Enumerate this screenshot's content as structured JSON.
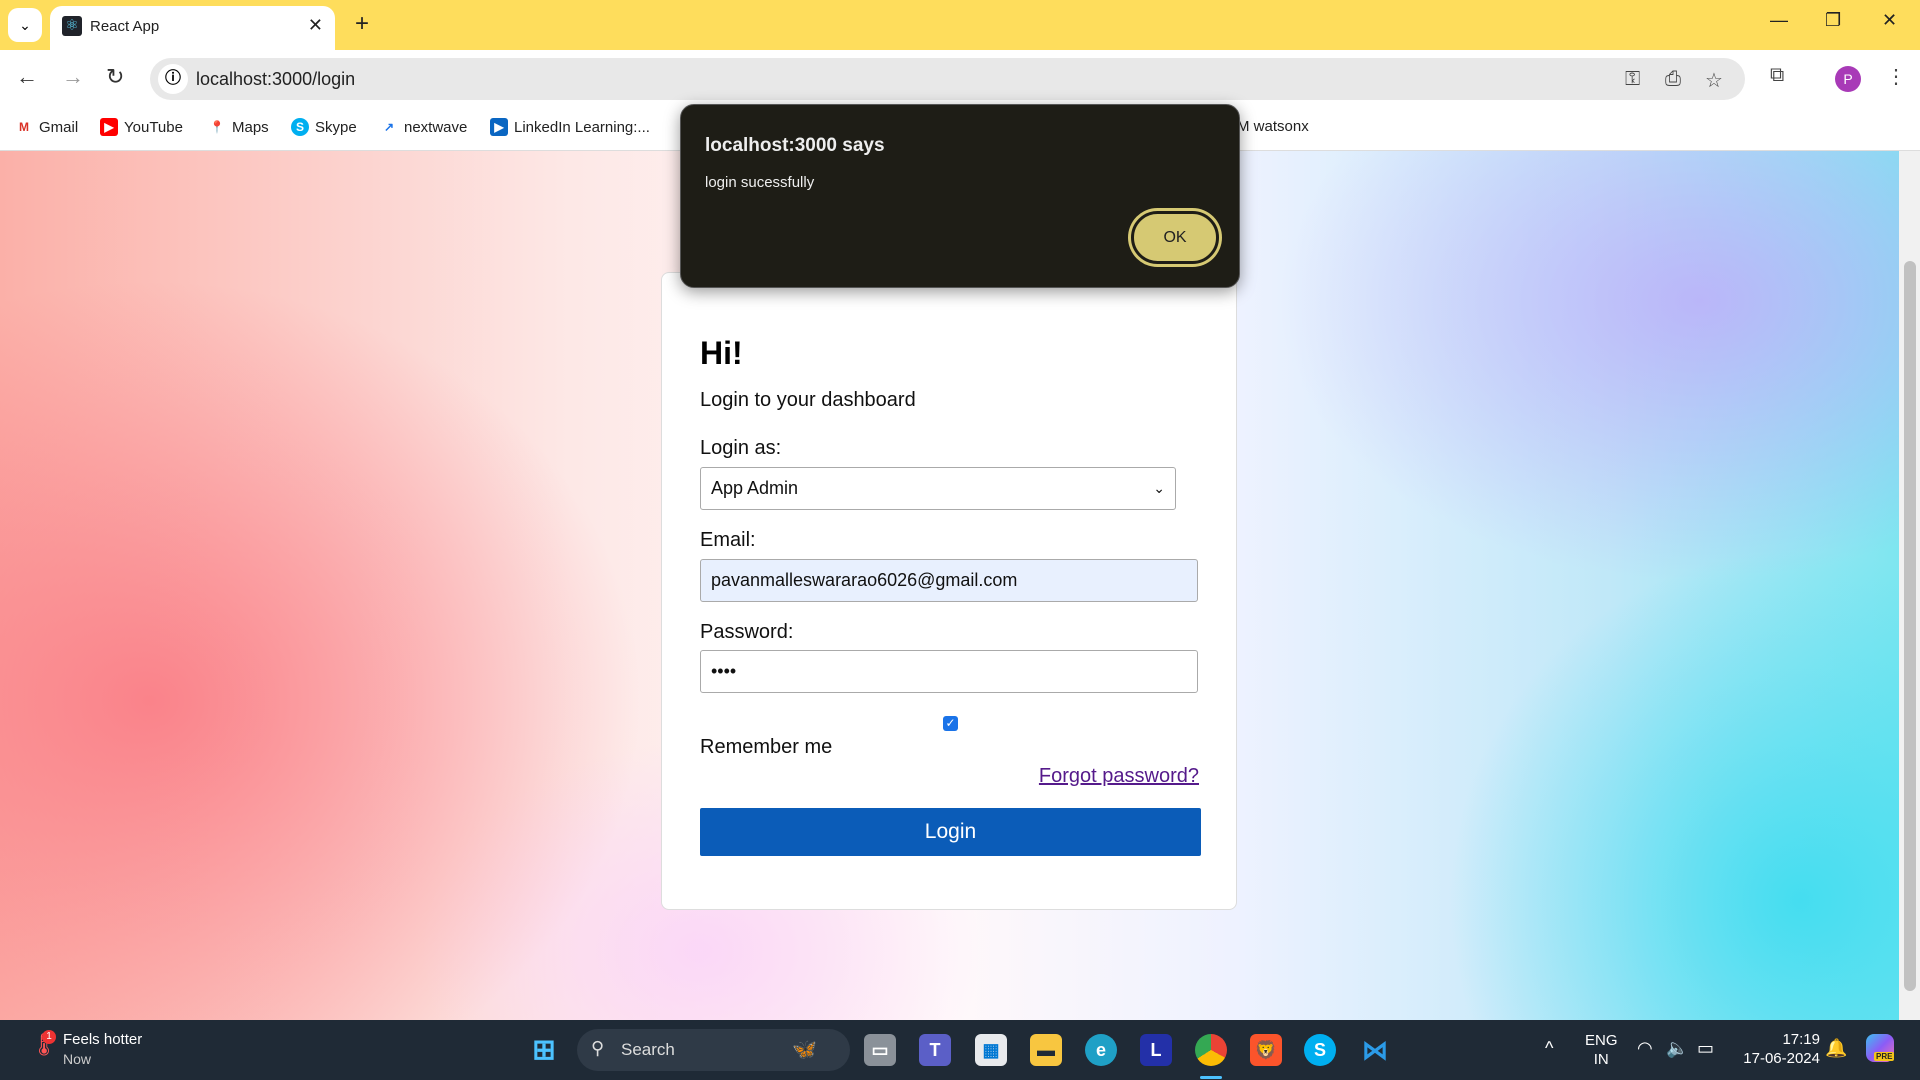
{
  "browser": {
    "tab_title": "React App",
    "url": "localhost:3000/login",
    "bookmarks": [
      "Gmail",
      "YouTube",
      "Maps",
      "Skype",
      "nextwave",
      "LinkedIn Learning:...",
      "M watsonx"
    ]
  },
  "dialog": {
    "title": "localhost:3000 says",
    "message": "login sucessfully",
    "ok_label": "OK"
  },
  "login": {
    "heading": "Hi!",
    "subheading": "Login to your dashboard",
    "login_as_label": "Login as:",
    "login_as_value": "App Admin",
    "email_label": "Email:",
    "email_value": "pavanmalleswararao6026@gmail.com",
    "password_label": "Password:",
    "password_value": "••••",
    "remember_label": "Remember me",
    "remember_checked": true,
    "forgot_label": "Forgot password?",
    "login_button": "Login",
    "accent": "#0b5cb8"
  },
  "taskbar": {
    "weather_title": "Feels hotter",
    "weather_sub": "Now",
    "weather_badge": "1",
    "search_label": "Search",
    "lang_1": "ENG",
    "lang_2": "IN",
    "time": "17:19",
    "date": "17-06-2024",
    "copilot_badge": "PRE"
  }
}
